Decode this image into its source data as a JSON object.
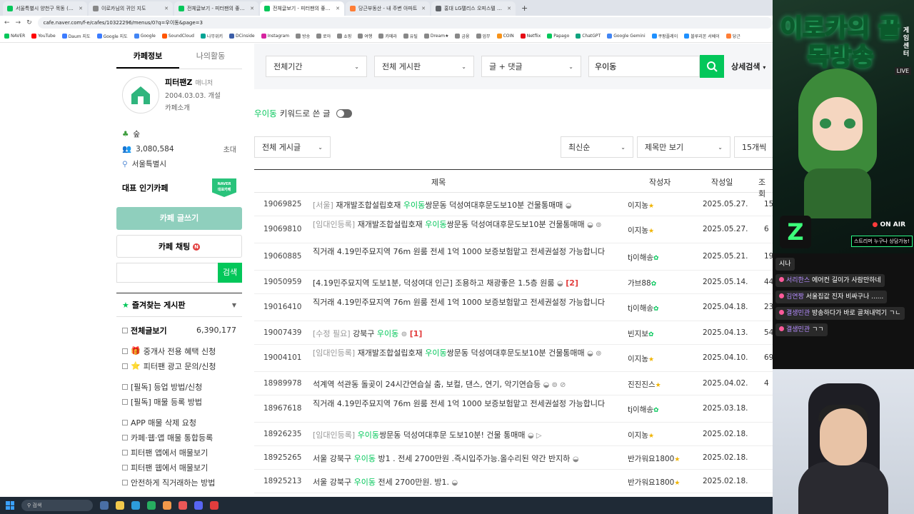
{
  "browser": {
    "tabs": [
      {
        "title": "서울특별시 양천구 목동 (월세)",
        "color": "#03c75a",
        "active": false
      },
      {
        "title": "이로카님의 귀인 지도",
        "color": "#888888",
        "active": false
      },
      {
        "title": "전체글보기 - 피터팬의 좋은방",
        "color": "#03c75a",
        "active": false
      },
      {
        "title": "전체글보기 - 피터팬의 좋은방",
        "color": "#03c75a",
        "active": true
      },
      {
        "title": "당근부동산 - 내 주변 아파트",
        "color": "#ff7e36",
        "active": false
      },
      {
        "title": "홍대 LG팰리스 오피스텔 월세",
        "color": "#5f6368",
        "active": false
      }
    ],
    "new_tab": "+",
    "url": "cafe.naver.com/f-e/cafes/10322296/menus/0?q=우이동&page=3",
    "bookmarks": [
      "NAVER",
      "YouTube",
      "Daum 지도",
      "Google 지도",
      "Google",
      "SoundCloud",
      "나무위키",
      "DCinside",
      "Instagram",
      "방송",
      "로아",
      "쇼핑",
      "여행",
      "카메라",
      "유틸",
      "Dream★",
      "금융",
      "업무",
      "COIN",
      "Netflix",
      "Papago",
      "ChatGPT",
      "Google Gemini",
      "쿠팡플레이",
      "블루리본 서베이",
      "당근"
    ]
  },
  "sidebar": {
    "tab_cafe": "카페정보",
    "tab_activity": "나의활동",
    "cafe_name": "피터팬Z",
    "manager_label": "매니저",
    "since": "2004.03.03. 개설",
    "intro": "카페소개",
    "level": "숲",
    "members": "3,080,584",
    "invite": "초대",
    "region": "서울특별시",
    "popular_label": "대표 인기카페",
    "badge_top": "NAVER",
    "badge_bottom": "대표카페",
    "write_button": "카페 글쓰기",
    "chat_button": "카페 채팅",
    "chat_new": "N",
    "search_button": "검색",
    "fav_header": "즐겨찾는 게시판",
    "all_posts": "전체글보기",
    "all_posts_count": "6,390,177",
    "menu_group1": [
      "중개사 전용 혜택 신청",
      "피터팬 광고 문의/신청"
    ],
    "menu_group2": [
      "[필독] 등업 방법/신청",
      "[필독] 매물 등록 방법"
    ],
    "menu_group3": [
      "APP 매물 삭제 요청",
      "카페·웹·앱 매물 통합등록",
      "피터팬 앱에서 매물보기",
      "피터팬 웹에서 매물보기",
      "안전하게 직거래하는 방법"
    ]
  },
  "filters": {
    "period": "전체기간",
    "board": "전체 게시판",
    "scope": "글 + 댓글",
    "keyword": "우이동",
    "advanced": "상세검색"
  },
  "keyword_line": {
    "keyword": "우이동",
    "suffix": "키워드로 쓴 글"
  },
  "list_controls": {
    "board_filter": "전체 게시글",
    "sort": "최신순",
    "view": "제목만 보기",
    "per_page": "15개씩"
  },
  "table": {
    "headers": {
      "title": "제목",
      "author": "작성자",
      "date": "작성일",
      "views": "조회"
    },
    "rows": [
      {
        "no": "19069825",
        "prefix": "[서울]",
        "parts": [
          "재개발조합설립호재 ",
          "우이동",
          "쌍문동 덕성여대후문도보10분 건물통매매"
        ],
        "icons": "◒",
        "comments": "",
        "author": "이지농",
        "badge": "★",
        "date": "2025.05.27.",
        "views": "15"
      },
      {
        "no": "19069810",
        "prefix": "[임대인등록]",
        "parts": [
          "재개발조합설립호재 ",
          "우이동",
          "쌍문동 덕성여대후문도보10분 건물통매매"
        ],
        "icons": "◒ ⊚",
        "comments": "",
        "author": "이지농",
        "badge": "★",
        "date": "2025.05.27.",
        "views": "6"
      },
      {
        "no": "19060885",
        "prefix": "",
        "parts": [
          "직거래 4.19민주묘지역 76m 원룸 전세 1억 1000 보증보험맡고 전세권설정 가능합니다",
          "",
          ""
        ],
        "icons": "",
        "comments": "",
        "author": "tj이해송",
        "badge": "leaf",
        "date": "2025.05.21.",
        "views": "19"
      },
      {
        "no": "19050959",
        "prefix": "",
        "parts": [
          "[4.19민주묘지역 도보1분, 덕성여대 인근] 조용하고 채광좋은 1.5층 원룸",
          "",
          ""
        ],
        "icons": "◒",
        "comments": "[2]",
        "author": "가브88",
        "badge": "leaf",
        "date": "2025.05.14.",
        "views": "443"
      },
      {
        "no": "19016410",
        "prefix": "",
        "parts": [
          "직거래 4.19민주묘지역 76m 원룸 전세 1억 1000 보증보험맡고 전세권설정 가능합니다",
          "",
          ""
        ],
        "icons": "",
        "comments": "",
        "author": "tj이해송",
        "badge": "leaf",
        "date": "2025.04.18.",
        "views": "23"
      },
      {
        "no": "19007439",
        "prefix": "[수정 필요]",
        "parts": [
          "강북구 ",
          "우이동",
          ""
        ],
        "icons": "⊚",
        "comments": "[1]",
        "author": "빈지보",
        "badge": "leaf",
        "date": "2025.04.13.",
        "views": "54"
      },
      {
        "no": "19004101",
        "prefix": "[임대인등록]",
        "parts": [
          "재개발조합설립호재 ",
          "우이동",
          "쌍문동 덕성여대후문도보10분 건물통매매"
        ],
        "icons": "◒ ⊚",
        "comments": "",
        "author": "이지농",
        "badge": "★",
        "date": "2025.04.10.",
        "views": "69"
      },
      {
        "no": "18989978",
        "prefix": "",
        "parts": [
          "석계역 석관동 돌곶이 24시간연습실 춤, 보컬, 댄스, 연기, 악기연습등",
          "",
          ""
        ],
        "icons": "◒ ⊚ ⊘",
        "comments": "",
        "author": "진진진스",
        "badge": "★",
        "date": "2025.04.02.",
        "views": "4"
      },
      {
        "no": "18967618",
        "prefix": "",
        "parts": [
          "직거래 4.19민주묘지역 76m 원룸 전세 1억 1000 보증보험맡고 전세권설정 가능합니다",
          "",
          ""
        ],
        "icons": "",
        "comments": "",
        "author": "tj이해송",
        "badge": "leaf",
        "date": "2025.03.18.",
        "views": ""
      },
      {
        "no": "18926235",
        "prefix": "[임대인등록]",
        "parts": [
          "",
          "우이동",
          "쌍문동 덕성여대후문 도보10분! 건물 통매매"
        ],
        "icons": "◒ ▷",
        "comments": "",
        "author": "이지농",
        "badge": "★",
        "date": "2025.02.18.",
        "views": ""
      },
      {
        "no": "18925265",
        "prefix": "",
        "parts": [
          "서울 강북구 ",
          "우이동",
          " 방1 . 전세 2700만원 .즉시입주가능.올수리된 약간 반지하"
        ],
        "icons": "◒",
        "comments": "",
        "author": "반가워요1800",
        "badge": "★",
        "date": "2025.02.18.",
        "views": ""
      },
      {
        "no": "18925213",
        "prefix": "",
        "parts": [
          "서울 강북구 ",
          "우이동",
          " 전세 2700만원. 방1."
        ],
        "icons": "◒",
        "comments": "",
        "author": "반가워요1800",
        "badge": "★",
        "date": "2025.02.18.",
        "views": ""
      }
    ]
  },
  "stream": {
    "title": "이로카의 골목방송",
    "side": "게임센터",
    "live": "LIVE",
    "on_air": "ON AIR",
    "on_sub": "스트리머 누구나 상담가능!",
    "chat": [
      {
        "user": "",
        "text": "시나"
      },
      {
        "user": "서리한스",
        "text": "에어컨 길이가 사람만하네"
      },
      {
        "user": "김연짱",
        "text": "서울집값 진자 비싸구나 ......"
      },
      {
        "user": "결생민관",
        "text": "방송하다가 바로 골쳐내먹기 ㄱㄴ"
      },
      {
        "user": "결생민관",
        "text": "ㄱㄱ"
      }
    ]
  },
  "taskbar": {
    "search": "검색"
  }
}
